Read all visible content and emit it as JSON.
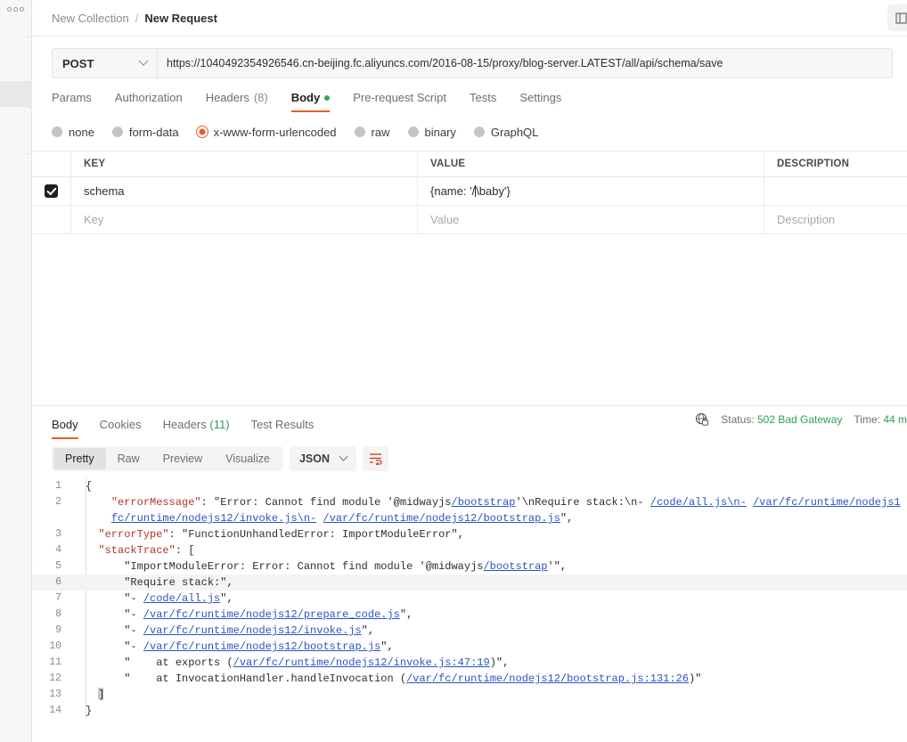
{
  "sidebar": {
    "menu_icon": "more-dots-icon"
  },
  "header": {
    "collection": "New Collection",
    "separator": "/",
    "request": "New Request",
    "action_icon": "panel-icon"
  },
  "request": {
    "method": "POST",
    "method_chevron": "chevron-down-icon",
    "url": "https://1040492354926546.cn-beijing.fc.aliyuncs.com/2016-08-15/proxy/blog-server.LATEST/all/api/schema/save",
    "tabs": [
      {
        "label": "Params",
        "active": false,
        "badge": ""
      },
      {
        "label": "Authorization",
        "active": false,
        "badge": ""
      },
      {
        "label": "Headers",
        "active": false,
        "badge": "(8)"
      },
      {
        "label": "Body",
        "active": true,
        "badge": "",
        "dot": true
      },
      {
        "label": "Pre-request Script",
        "active": false,
        "badge": ""
      },
      {
        "label": "Tests",
        "active": false,
        "badge": ""
      },
      {
        "label": "Settings",
        "active": false,
        "badge": ""
      }
    ],
    "body_types": [
      {
        "label": "none",
        "selected": false
      },
      {
        "label": "form-data",
        "selected": false
      },
      {
        "label": "x-www-form-urlencoded",
        "selected": true
      },
      {
        "label": "raw",
        "selected": false
      },
      {
        "label": "binary",
        "selected": false
      },
      {
        "label": "GraphQL",
        "selected": false
      }
    ],
    "table": {
      "columns": [
        "KEY",
        "VALUE",
        "DESCRIPTION"
      ],
      "rows": [
        {
          "checked": true,
          "key": "schema",
          "value_prefix": "{name: '/",
          "value_suffix": "\\baby'}",
          "description": ""
        }
      ],
      "placeholder_row": {
        "key": "Key",
        "value": "Value",
        "description": "Description"
      }
    }
  },
  "response": {
    "tabs": [
      {
        "label": "Body",
        "active": true,
        "badge": ""
      },
      {
        "label": "Cookies",
        "active": false,
        "badge": ""
      },
      {
        "label": "Headers",
        "active": false,
        "badge": "(11)"
      },
      {
        "label": "Test Results",
        "active": false,
        "badge": ""
      }
    ],
    "security_icon": "globe-lock-icon",
    "status_label": "Status:",
    "status_value": "502 Bad Gateway",
    "time_label": "Time:",
    "time_value": "44 m",
    "view_modes": [
      {
        "label": "Pretty",
        "active": true
      },
      {
        "label": "Raw",
        "active": false
      },
      {
        "label": "Preview",
        "active": false
      },
      {
        "label": "Visualize",
        "active": false
      }
    ],
    "format": "JSON",
    "format_chevron": "chevron-down-icon",
    "wrap_icon": "wrap-lines-icon",
    "colors": {
      "accent": "#ef5b25",
      "success": "#27a05b",
      "key": "#b5332a",
      "link": "#2b53c6"
    },
    "code_lines": [
      {
        "num": "1",
        "highlight": false
      },
      {
        "num": "2",
        "highlight": false
      },
      {
        "num": "",
        "highlight": false
      },
      {
        "num": "3",
        "highlight": false
      },
      {
        "num": "4",
        "highlight": false
      },
      {
        "num": "5",
        "highlight": false
      },
      {
        "num": "6",
        "highlight": true
      },
      {
        "num": "7",
        "highlight": false
      },
      {
        "num": "8",
        "highlight": false
      },
      {
        "num": "9",
        "highlight": false
      },
      {
        "num": "10",
        "highlight": false
      },
      {
        "num": "11",
        "highlight": false
      },
      {
        "num": "12",
        "highlight": false
      },
      {
        "num": "13",
        "highlight": false
      },
      {
        "num": "14",
        "highlight": false
      }
    ],
    "code_text": {
      "l1": "{",
      "l2_key": "\"errorMessage\"",
      "l2_a": ": \"Error: Cannot find module '@midwayjs",
      "l2_link1": "/bootstrap",
      "l2_b": "'\\nRequire stack:\\n- ",
      "l2_link2": "/code/all.js\\n-",
      "l2_c": " ",
      "l2_link3": "/var/fc/runtime/nodejs1",
      "l2w_link1": "fc/runtime/nodejs12/invoke.js\\n-",
      "l2w_c": " ",
      "l2w_link2": "/var/fc/runtime/nodejs12/bootstrap.js",
      "l2w_end": "\",",
      "l3_key": "\"errorType\"",
      "l3_rest": ": \"FunctionUnhandledError: ImportModuleError\",",
      "l4_key": "\"stackTrace\"",
      "l4_rest": ": [",
      "l5_a": "\"ImportModuleError: Error: Cannot find module '@midwayjs",
      "l5_link": "/bootstrap",
      "l5_b": "'\",",
      "l6": "\"Require stack:\",",
      "l7_a": "\"- ",
      "l7_link": "/code/all.js",
      "l7_b": "\",",
      "l8_a": "\"- ",
      "l8_link": "/var/fc/runtime/nodejs12/prepare_code.js",
      "l8_b": "\",",
      "l9_a": "\"- ",
      "l9_link": "/var/fc/runtime/nodejs12/invoke.js",
      "l9_b": "\",",
      "l10_a": "\"- ",
      "l10_link": "/var/fc/runtime/nodejs12/bootstrap.js",
      "l10_b": "\",",
      "l11_a": "\"    at exports (",
      "l11_link": "/var/fc/runtime/nodejs12/invoke.js:47:19",
      "l11_b": ")\",",
      "l12_a": "\"    at InvocationHandler.handleInvocation (",
      "l12_link": "/var/fc/runtime/nodejs12/bootstrap.js:131:26",
      "l12_b": ")\"",
      "l13": "]",
      "l14": "}"
    }
  }
}
